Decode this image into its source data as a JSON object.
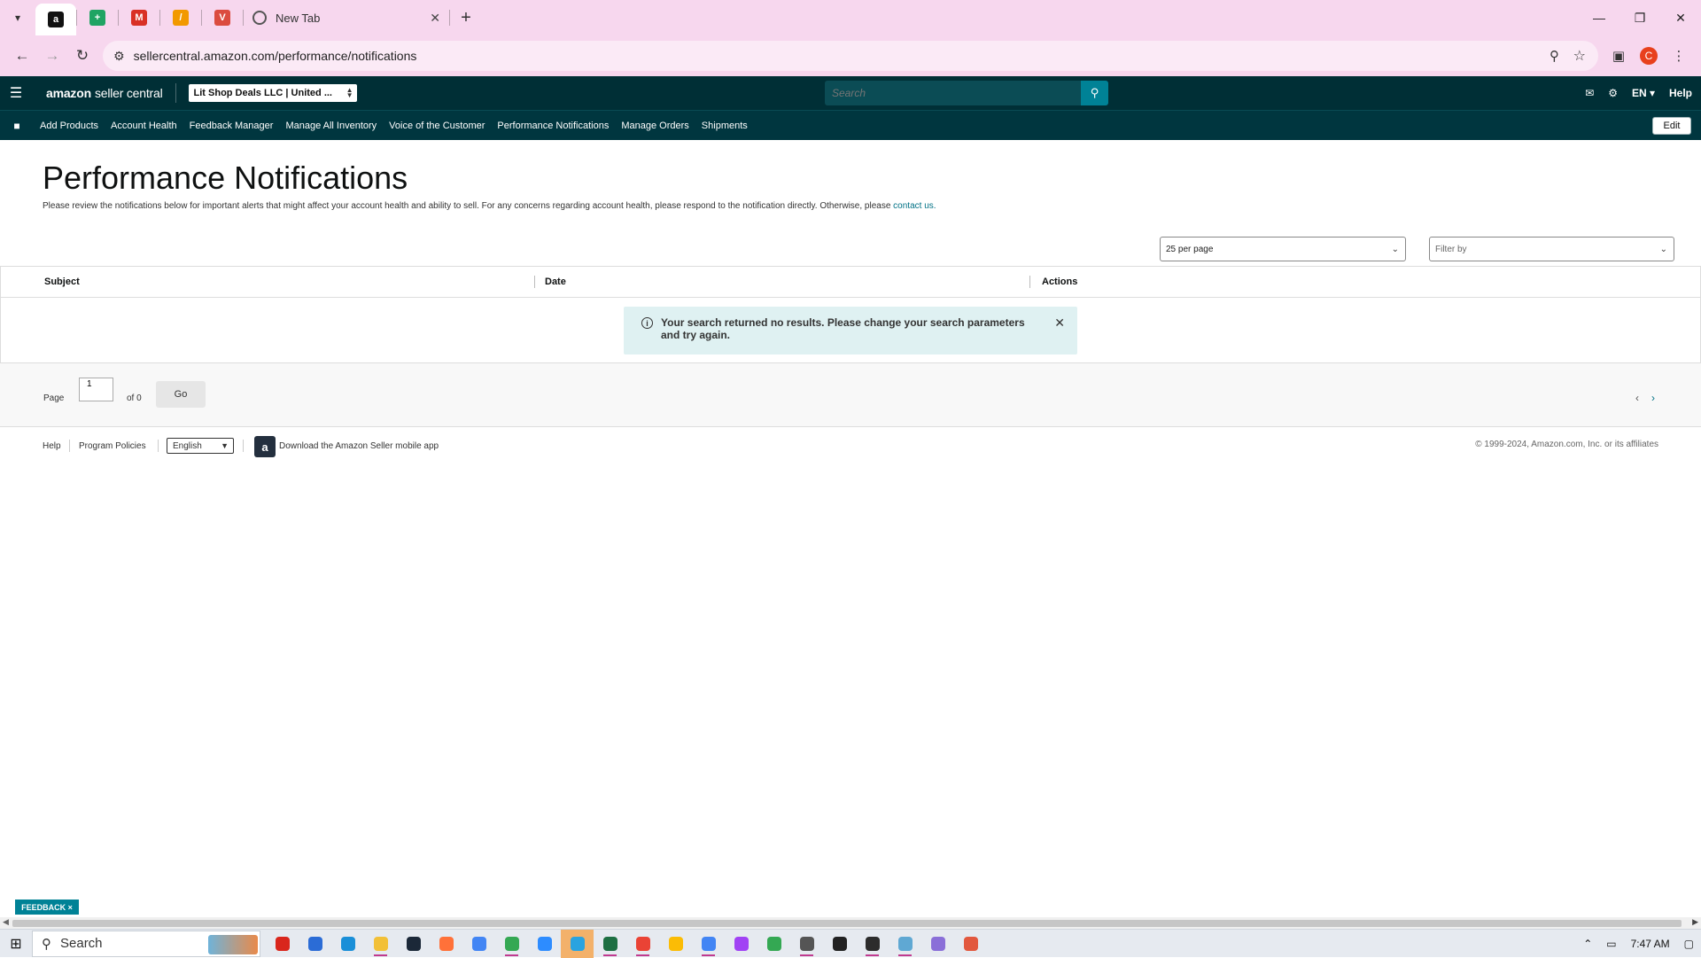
{
  "browser": {
    "tab_new_label": "New Tab",
    "url": "sellercentral.amazon.com/performance/notifications",
    "profile_initial": "C",
    "pinned_tabs": [
      {
        "name": "amazon",
        "glyph": "a",
        "color": "#111111"
      },
      {
        "name": "sheets",
        "glyph": "+",
        "color": "#1fa463"
      },
      {
        "name": "gmail",
        "glyph": "M",
        "color": "#d93025"
      },
      {
        "name": "tool",
        "glyph": "/",
        "color": "#f29900"
      },
      {
        "name": "todoist",
        "glyph": "V",
        "color": "#db4c3f"
      }
    ]
  },
  "header": {
    "logo_main": "amazon",
    "logo_sub": "seller central",
    "account": "Lit Shop Deals LLC | United ...",
    "search_placeholder": "Search",
    "lang": "EN ▾",
    "help": "Help"
  },
  "nav": {
    "items": [
      "Add Products",
      "Account Health",
      "Feedback Manager",
      "Manage All Inventory",
      "Voice of the Customer",
      "Performance Notifications",
      "Manage Orders",
      "Shipments"
    ],
    "edit": "Edit"
  },
  "main": {
    "title": "Performance Notifications",
    "intro": "Please review the notifications below for important alerts that might affect your account health and ability to sell. For any concerns regarding account health, please respond to the notification directly. Otherwise, please",
    "intro_link": "contact us.",
    "per_page": "25 per page",
    "filter_placeholder": "Filter by",
    "columns": [
      "Subject",
      "Date",
      "Actions"
    ],
    "alert": "Your search returned no results. Please change your search parameters and try again.",
    "page_label": "Page",
    "page_value": "1",
    "of_label": "of 0",
    "go": "Go"
  },
  "footer": {
    "help": "Help",
    "program_policies": "Program Policies",
    "language": "English",
    "app_text": "Download the Amazon Seller mobile app",
    "copyright": "© 1999-2024, Amazon.com, Inc. or its affiliates"
  },
  "feedback_tab": "FEEDBACK ×",
  "taskbar": {
    "search": "Search",
    "time": "7:47 AM",
    "apps": [
      {
        "name": "app-red",
        "color": "#d9261c",
        "open": false
      },
      {
        "name": "app-store",
        "color": "#2b6cd6",
        "open": false
      },
      {
        "name": "edge",
        "color": "#1a8fd8",
        "open": false
      },
      {
        "name": "file-explorer",
        "color": "#f2c037",
        "open": true
      },
      {
        "name": "steam",
        "color": "#1b2838",
        "open": false
      },
      {
        "name": "firefox",
        "color": "#ff7139",
        "open": false
      },
      {
        "name": "chrome",
        "color": "#4285f4",
        "open": false
      },
      {
        "name": "chrome-profile-2",
        "color": "#34a853",
        "open": true
      },
      {
        "name": "zoom",
        "color": "#2d8cff",
        "open": false
      },
      {
        "name": "telegram",
        "color": "#2aa3e0",
        "open": false,
        "highlight": true
      },
      {
        "name": "excel",
        "color": "#1d6f42",
        "open": true
      },
      {
        "name": "chrome-profile-3",
        "color": "#ea4335",
        "open": true
      },
      {
        "name": "chrome-profile-4",
        "color": "#fbbc05",
        "open": false
      },
      {
        "name": "chrome-profile-5",
        "color": "#4285f4",
        "open": true
      },
      {
        "name": "chrome-profile-6",
        "color": "#a142f4",
        "open": false
      },
      {
        "name": "chrome-profile-7",
        "color": "#34a853",
        "open": false
      },
      {
        "name": "calculator",
        "color": "#555555",
        "open": true
      },
      {
        "name": "obs",
        "color": "#222222",
        "open": false
      },
      {
        "name": "sticky-app",
        "color": "#2c2c2c",
        "open": true
      },
      {
        "name": "notepad",
        "color": "#5fa8d3",
        "open": true
      },
      {
        "name": "snipping-tool",
        "color": "#8a6fd8",
        "open": false
      },
      {
        "name": "paint",
        "color": "#e2583e",
        "open": false
      }
    ]
  }
}
